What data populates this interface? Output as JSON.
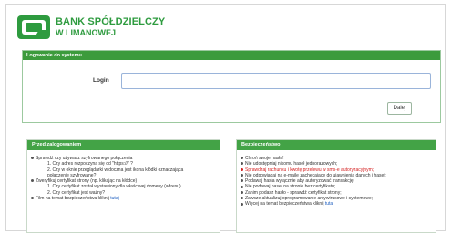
{
  "header": {
    "bank_line1": "BANK SPÓŁDZIELCZY",
    "bank_line2": "W LIMANOWEJ"
  },
  "login": {
    "panel_title": "Logowanie do systemu",
    "label": "Login",
    "value": "",
    "next_button": "Dalej"
  },
  "before_login": {
    "title": "Przed zalogowaniem",
    "items": [
      "Sprawdź czy używasz szyfrowanego połączenia",
      "1. Czy adres rozpoczyna się od \"https://\" ?",
      "2. Czy w oknie przeglądarki widoczna jest ikona kłódki oznaczająca",
      "połączenie szyfrowane?",
      "Zweryfikuj certyfikat strony (np. klikając na kłódce)",
      "1. Czy certyfikat został wystawiony dla właściwej domeny (adresu)",
      "2. Czy certyfikat jest ważny?",
      "Film na temat bezpieczeństwa kliknij"
    ],
    "link_label": "tutaj"
  },
  "security": {
    "title": "Bezpieczeństwo",
    "items": [
      "Chroń swoje hasła!",
      "Nie udostępniaj nikomu haseł jednorazowych;",
      "Sprawdzaj rachunku i kwotę przelewu w sms-e autoryzacyjnym;",
      "Nie odpowiadaj na e-maile zachęcające do ujawnienia danych i haseł;",
      "Podawaj hasła wyłącznie aby autoryzować transakcję;",
      "Nie podawaj haseł na stronie bez certyfikatu;",
      "Zanim podasz hasło - sprawdź certyfikat strony;",
      "Zawsze aktualizuj oprogramowanie antywirusowe i systemowe;",
      "Więcej na temat bezpieczeństwa kliknij"
    ],
    "link_label": "tutaj"
  },
  "colors": {
    "brand_green": "#2e9b3f",
    "bar_green": "#3c9b3c",
    "warning_red": "#d42020",
    "link_blue": "#2060c0"
  }
}
